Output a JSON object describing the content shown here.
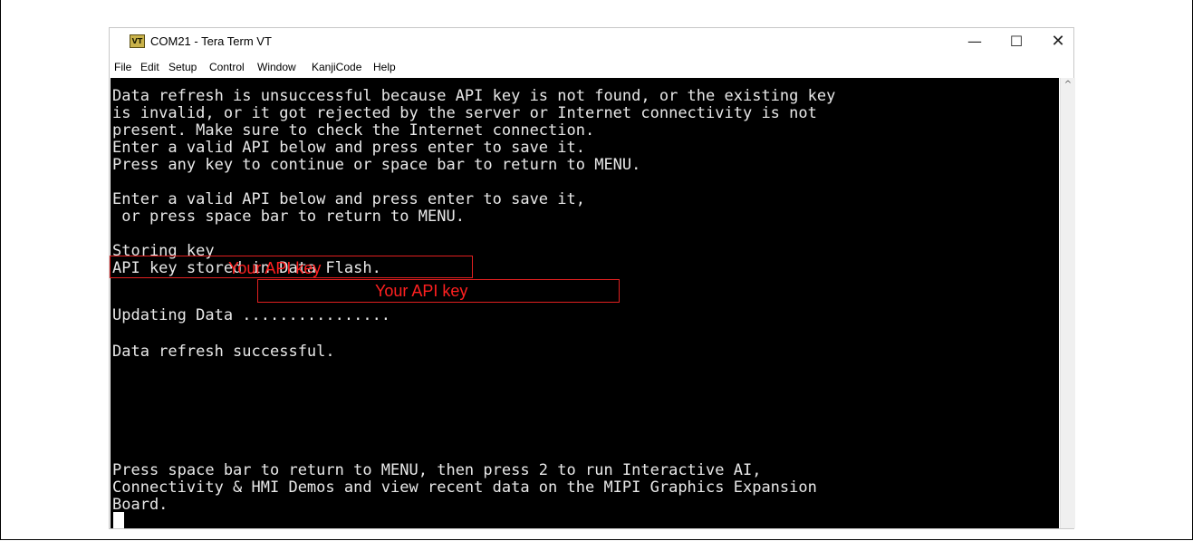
{
  "window": {
    "title": "COM21 - Tera Term VT",
    "app_icon_label": "VT",
    "controls": {
      "minimize": "—",
      "maximize": "☐",
      "close": "✕"
    }
  },
  "menu": {
    "items": [
      {
        "label": "File"
      },
      {
        "label": "Edit"
      },
      {
        "label": "Setup"
      },
      {
        "label": "Control"
      },
      {
        "label": "Window"
      },
      {
        "label": "KanjiCode"
      },
      {
        "label": "Help"
      }
    ]
  },
  "terminal": {
    "lines": [
      "Data refresh is unsuccessful because API key is not found, or the existing key",
      "is invalid, or it got rejected by the server or Internet connectivity is not",
      "present. Make sure to check the Internet connection.",
      "Enter a valid API below and press enter to save it.",
      "Press any key to continue or space bar to return to MENU.",
      "",
      "Enter a valid API below and press enter to save it,",
      " or press space bar to return to MENU.",
      "",
      "Storing key",
      "API key stored in Data Flash.",
      "",
      "Updating Data ................",
      "",
      "Data refresh successful.",
      "",
      "Press space bar to return to MENU, then press 2 to run Interactive AI,",
      "Connectivity & HMI Demos and view recent data on the MIPI Graphics Expansion",
      "Board."
    ]
  },
  "annotations": {
    "api_key_input": "Your API key",
    "api_key_stored": "Your API key"
  },
  "scrollbar": {
    "up_arrow": "^"
  },
  "colors": {
    "terminal_bg": "#000000",
    "terminal_fg": "#e8e8e8",
    "annotation": "#ff2020"
  }
}
